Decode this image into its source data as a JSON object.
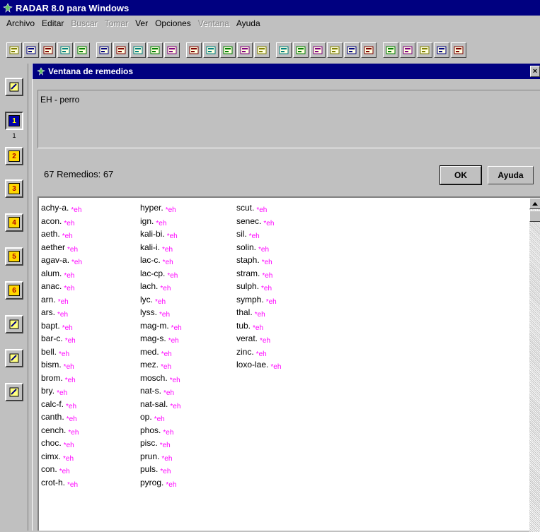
{
  "app": {
    "title": "RADAR 8.0 para Windows"
  },
  "menu": [
    {
      "label": "Archivo",
      "enabled": true
    },
    {
      "label": "Editar",
      "enabled": true
    },
    {
      "label": "Buscar",
      "enabled": false
    },
    {
      "label": "Tomar",
      "enabled": false
    },
    {
      "label": "Ver",
      "enabled": true
    },
    {
      "label": "Opciones",
      "enabled": true
    },
    {
      "label": "Ventana",
      "enabled": false
    },
    {
      "label": "Ayuda",
      "enabled": true
    }
  ],
  "toolbar_icons": [
    [
      "open-icon",
      "find-icon",
      "zoom-icon",
      "lookup-icon",
      "magnifier-icon"
    ],
    [
      "clipboard-icon",
      "clip-1-icon",
      "clip-2-icon",
      "clip-3-icon",
      "clip-4-icon"
    ],
    [
      "bar-chart-icon",
      "symbol-icon",
      "table-icon",
      "people-icon",
      "list-icon"
    ],
    [
      "gear-yellow-icon",
      "gear-red-icon",
      "gear-blue-icon",
      "document-icon",
      "keys-icon",
      "window-icon"
    ],
    [
      "globe-icon",
      "printer-icon",
      "book-icon",
      "book-search-icon",
      "help-icon"
    ]
  ],
  "rail": {
    "items": [
      {
        "icon": "pointer-icon",
        "label": ""
      },
      {
        "icon": "clipboard-1-icon",
        "label": "1",
        "badge": "1"
      },
      {
        "icon": "clipboard-2-icon",
        "label": "",
        "badge": "2"
      },
      {
        "icon": "clipboard-3-icon",
        "label": "",
        "badge": "3"
      },
      {
        "icon": "clipboard-4-icon",
        "label": "",
        "badge": "4"
      },
      {
        "icon": "clipboard-5-icon",
        "label": "",
        "badge": "5"
      },
      {
        "icon": "clipboard-6-icon",
        "label": "",
        "badge": "6"
      },
      {
        "icon": "copy-icon",
        "label": ""
      },
      {
        "icon": "edit-icon",
        "label": ""
      },
      {
        "icon": "lightbulb-icon",
        "label": ""
      }
    ]
  },
  "window": {
    "title": "Ventana de remedios",
    "close_label": "×",
    "rubric": "EH - perro",
    "summary": "67 Remedios: 67",
    "ok_label": "OK",
    "help_label": "Ayuda",
    "grade_label": "*eh",
    "colors": {
      "grade": "#ff00ff",
      "title_bg": "#000080"
    },
    "columns": [
      [
        "achy-a.",
        "acon.",
        "aeth.",
        "aether",
        "agav-a.",
        "alum.",
        "anac.",
        "arn.",
        "ars.",
        "bapt.",
        "bar-c.",
        "bell.",
        "bism.",
        "brom.",
        "bry.",
        "calc-f.",
        "canth.",
        "cench.",
        "choc.",
        "cimx.",
        "con.",
        "crot-h."
      ],
      [
        "hyper.",
        "ign.",
        "kali-bi.",
        "kali-i.",
        "lac-c.",
        "lac-cp.",
        "lach.",
        "lyc.",
        "lyss.",
        "mag-m.",
        "mag-s.",
        "med.",
        "mez.",
        "mosch.",
        "nat-s.",
        "nat-sal.",
        "op.",
        "phos.",
        "pisc.",
        "prun.",
        "puls.",
        "pyrog."
      ],
      [
        "scut.",
        "senec.",
        "sil.",
        "solin.",
        "staph.",
        "stram.",
        "sulph.",
        "symph.",
        "thal.",
        "tub.",
        "verat.",
        "zinc.",
        "loxo-lae."
      ]
    ]
  }
}
